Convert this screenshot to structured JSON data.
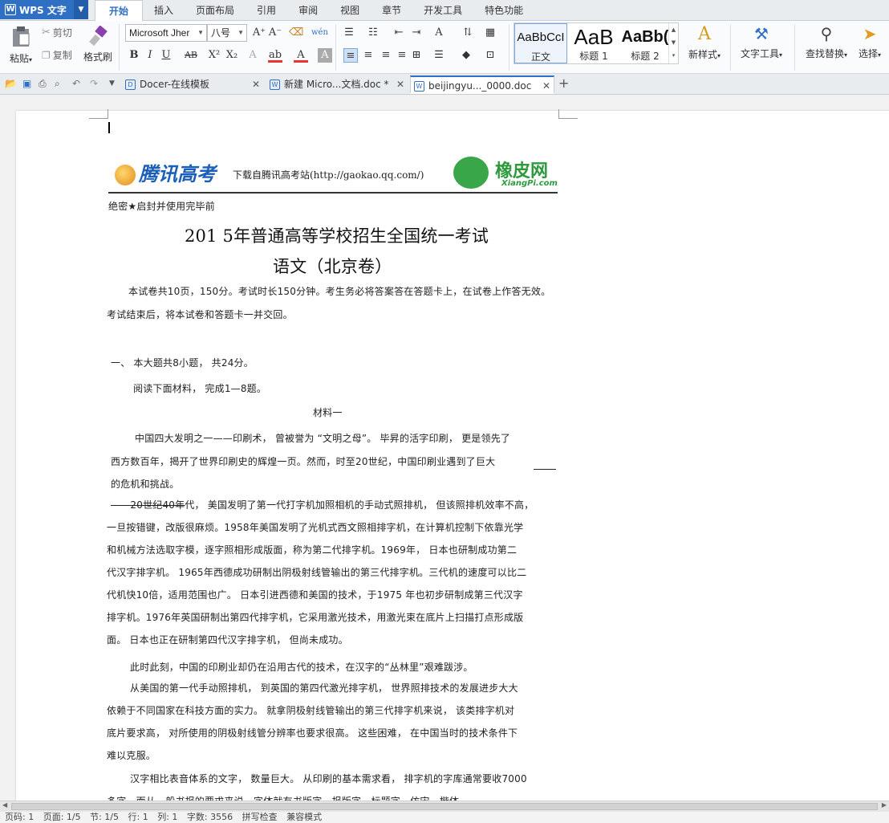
{
  "app": {
    "name": "WPS 文字",
    "menu_tabs": [
      "开始",
      "插入",
      "页面布局",
      "引用",
      "审阅",
      "视图",
      "章节",
      "开发工具",
      "特色功能"
    ],
    "active_tab": "开始"
  },
  "ribbon": {
    "paste": "粘贴",
    "cut": "剪切",
    "copy": "复制",
    "format_painter": "格式刷",
    "font_name": "Microsoft Jher",
    "font_size": "八号",
    "styles": [
      {
        "sample": "AaBbCcI",
        "name": "正文"
      },
      {
        "sample": "AaB",
        "name": "标题 1"
      },
      {
        "sample": "AaBb(",
        "name": "标题 2"
      }
    ],
    "new_style": "新样式",
    "text_tools": "文字工具",
    "find_replace": "查找替换",
    "select": "选择"
  },
  "doc_tabs": [
    {
      "title": "Docer-在线模板",
      "active": false
    },
    {
      "title": "新建 Micro...文档.doc *",
      "active": false
    },
    {
      "title": "beijingyu..._0000.doc",
      "active": true
    }
  ],
  "document": {
    "header_text": "下载自腾讯高考站(http://gaokao.qq.com/)",
    "logo_left": "腾讯高考",
    "logo_right": "橡皮网",
    "logo_right_sub": "XiangPi.com",
    "secret": "绝密★启封并使用完毕前",
    "title1": "201  5年普通高等学校招生全国统一考试",
    "title2": "语文（北京卷）",
    "intro1": "本试卷共10页，150分。考试时长150分钟。考生务必将答案答在答题卡上，在试卷上作答无效。",
    "intro2": "考试结束后，将本试卷和答题卡一并交回。",
    "section1": "一、  本大题共8小题，  共24分。",
    "read": "阅读下面材料，  完成1—8题。",
    "material": "材料一",
    "p1": [
      "中国四大发明之一——印刷术，  曾被誉为  “文明之母”。  毕昇的活字印刷，  更是领先了",
      "西方数百年，揭开了世界印刷史的辉煌一页。然而，时至20世纪，中国印刷业遇到了巨大",
      "的危机和挑战。"
    ],
    "p2_strike": "——20世纪40年",
    "p2": [
      "代，  美国发明了第一代打字机加照相机的手动式照排机，  但该照排机效率不高，",
      "一旦按错键，改版很麻烦。1958年美国发明了光机式西文照相排字机，在计算机控制下依靠光学",
      "和机械方法选取字模，逐字照相形成版面，称为第二代排字机。1969年，    日本也研制成功第二",
      "代汉字排字机。  1965年西德成功研制出阴极射线管输出的第三代排字机。三代机的速度可以比二",
      "代机快10倍，适用范围也广。  日本引进西德和美国的技术，于1975  年也初步研制成第三代汉字",
      "排字机。1976年英国研制出第四代排字机，它采用激光技术，用激光束在底片上扫描打点形成版",
      "面。  日本也正在研制第四代汉字排字机，  但尚未成功。"
    ],
    "p3": "此时此刻，中国的印刷业却仍在沿用古代的技术，在汉字的“丛林里”艰难跋涉。",
    "p4": [
      "从美国的第一代手动照排机，  到英国的第四代激光排字机，  世界照排技术的发展进步大大",
      "依赖于不同国家在科技方面的实力。  就拿阴极射线管输出的第三代排字机来说，  该类排字机对",
      "底片要求高，  对所使用的阴极射线管分辨率也要求很高。  这些困难，  在中国当时的技术条件下",
      "难以克服。"
    ],
    "p5": [
      "汉字相比表音体系的文字，  数量巨大。  从印刷的基本需求看，  排字机的字库通常要收7000",
      "多字，而从一般书报的要求来说，字体就有书版字、报版字、标题字、仿宋、楷体、"
    ]
  },
  "statusbar": [
    "页码: 1",
    "页面: 1/5",
    "节: 1/5",
    "行: 1",
    "列: 1",
    "字数: 3556",
    "拼写检查",
    "兼容模式"
  ]
}
